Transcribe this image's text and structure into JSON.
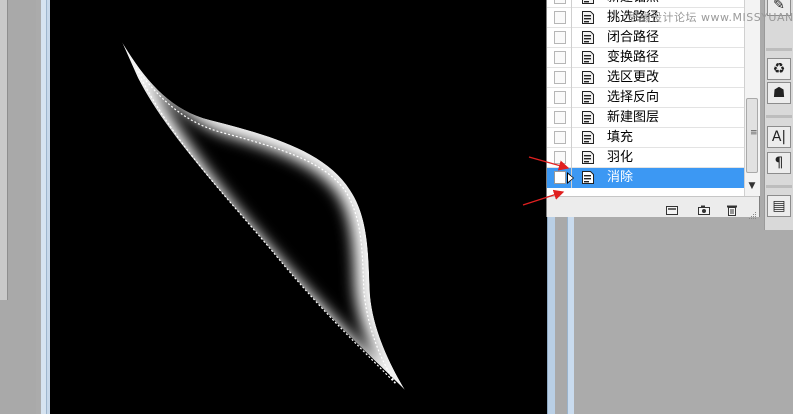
{
  "history": {
    "items": [
      {
        "label": "新建锚点",
        "selected": false,
        "current": false
      },
      {
        "label": "挑选路径",
        "selected": false,
        "current": false
      },
      {
        "label": "闭合路径",
        "selected": false,
        "current": false
      },
      {
        "label": "变换路径",
        "selected": false,
        "current": false
      },
      {
        "label": "选区更改",
        "selected": false,
        "current": false
      },
      {
        "label": "选择反向",
        "selected": false,
        "current": false
      },
      {
        "label": "新建图层",
        "selected": false,
        "current": false
      },
      {
        "label": "填充",
        "selected": false,
        "current": false
      },
      {
        "label": "羽化",
        "selected": false,
        "current": false
      },
      {
        "label": "消除",
        "selected": true,
        "current": true
      }
    ],
    "footer_buttons": [
      "new-document-from-state-icon",
      "new-snapshot-icon",
      "delete-icon"
    ]
  },
  "tools": [
    {
      "name": "brush-preset-icon",
      "glyph": "✎"
    },
    {
      "name": "clone-source-icon",
      "glyph": "♻"
    },
    {
      "name": "stamp-icon",
      "glyph": "☗"
    },
    {
      "name": "character-icon",
      "glyph": "A|"
    },
    {
      "name": "paragraph-icon",
      "glyph": "¶"
    },
    {
      "name": "layer-comps-icon",
      "glyph": "▤"
    }
  ],
  "watermark": "思缘设计论坛 www.MISSYUAN.COM",
  "colors": {
    "selection_highlight": "#3c98f3",
    "canvas": "#000000",
    "annotation_arrow": "#e02020"
  }
}
